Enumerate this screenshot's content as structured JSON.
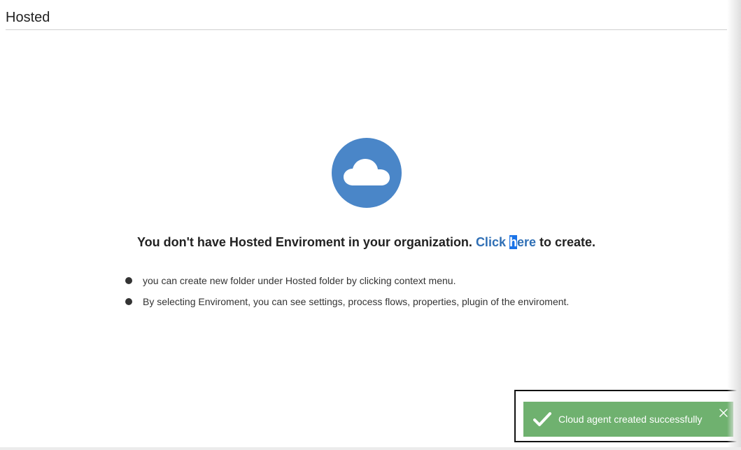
{
  "header": {
    "title": "Hosted"
  },
  "empty_state": {
    "icon": "cloud-icon",
    "icon_color": "#4a86c8",
    "message_prefix": "You don't have Hosted Enviroment in your organization. ",
    "link_click": "Click ",
    "link_h": "h",
    "link_rest": "ere",
    "message_suffix": " to create.",
    "link_color": "#2f6fb5"
  },
  "hints": [
    "you can create new folder under Hosted folder by clicking context menu.",
    "By selecting Enviroment, you can see settings, process flows, properties, plugin of the enviroment."
  ],
  "toast": {
    "message": "Cloud agent created successfully",
    "icon": "check-icon",
    "close_icon": "close-icon",
    "color": "#6fb16f"
  }
}
